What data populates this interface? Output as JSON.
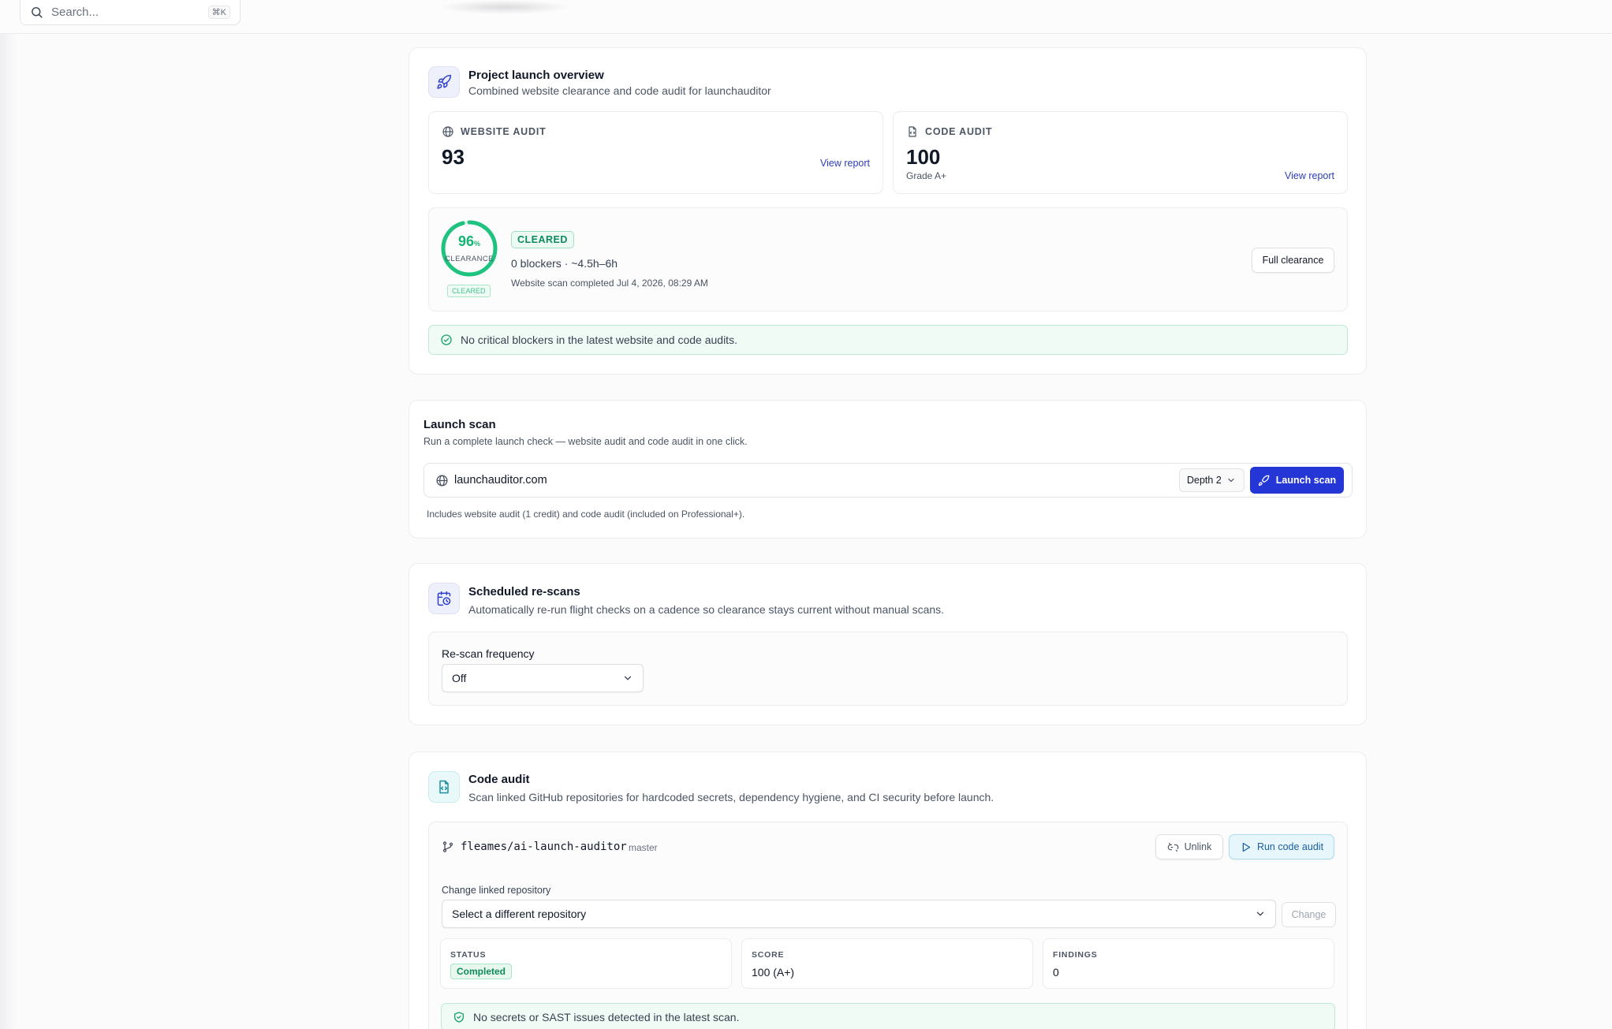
{
  "topbar": {
    "search_placeholder": "Search...",
    "search_shortcut": "⌘K"
  },
  "overview": {
    "title": "Project launch overview",
    "subtitle": "Combined website clearance and code audit for launchauditor",
    "website_audit": {
      "label": "WEBSITE AUDIT",
      "score": "93",
      "link": "View report"
    },
    "code_audit": {
      "label": "CODE AUDIT",
      "score": "100",
      "grade": "Grade A+",
      "link": "View report"
    },
    "clearance": {
      "percent": 96,
      "gauge_value": "96",
      "gauge_unit": "%",
      "gauge_label": "CLEARANCE",
      "gauge_badge": "CLEARED",
      "status_badge": "CLEARED",
      "summary": "0 blockers · ~4.5h–6h",
      "completed": "Website scan completed Jul 4, 2026, 08:29 AM",
      "button": "Full clearance"
    },
    "alert": "No critical blockers in the latest website and code audits."
  },
  "launch_scan": {
    "title": "Launch scan",
    "subtitle": "Run a complete launch check — website audit and code audit in one click.",
    "url": "launchauditor.com",
    "depth": "Depth 2",
    "button": "Launch scan",
    "note": "Includes website audit (1 credit) and code audit (included on Professional+)."
  },
  "scheduled": {
    "title": "Scheduled re-scans",
    "subtitle": "Automatically re-run flight checks on a cadence so clearance stays current without manual scans.",
    "frequency_label": "Re-scan frequency",
    "frequency_value": "Off"
  },
  "code_audit": {
    "title": "Code audit",
    "subtitle": "Scan linked GitHub repositories for hardcoded secrets, dependency hygiene, and CI security before launch.",
    "repo": "fleames/ai-launch-auditor",
    "branch": "master",
    "unlink_button": "Unlink",
    "run_button": "Run code audit",
    "change_label": "Change linked repository",
    "change_placeholder": "Select a different repository",
    "change_button": "Change",
    "stats": {
      "status_label": "STATUS",
      "status_value": "Completed",
      "score_label": "SCORE",
      "score_value": "100 (A+)",
      "findings_label": "FINDINGS",
      "findings_value": "0"
    },
    "alert": "No secrets or SAST issues detected in the latest scan."
  },
  "colors": {
    "accent": "#2536d6",
    "success": "#1fc27f",
    "run_button_bg": "#e6f6fb"
  }
}
